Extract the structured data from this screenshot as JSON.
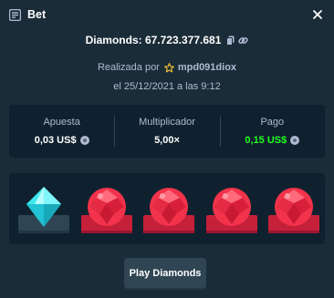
{
  "header": {
    "title": "Bet"
  },
  "bet": {
    "diamonds_label": "Diamonds: 67.723.377.681",
    "realizada_prefix": "Realizada por",
    "username": "mpd091diox",
    "date": "el 25/12/2021 a las 9:12"
  },
  "stats": {
    "apuesta_label": "Apuesta",
    "apuesta_value": "0,03 US$",
    "multiplicador_label": "Multiplicador",
    "multiplicador_value": "5,00×",
    "pago_label": "Pago",
    "pago_value": "0,15 US$"
  },
  "board": {
    "gems": [
      "cyan",
      "red",
      "red",
      "red",
      "red"
    ],
    "colors": {
      "cyan": "#3de8f0",
      "red": "#f2334b",
      "red_base": "#c5203a",
      "cyan_base": "#2f4553"
    }
  },
  "actions": {
    "play_label": "Play Diamonds"
  },
  "icons": {
    "bet": "bet-slip-icon",
    "close": "close-icon",
    "copy": "copy-icon",
    "link": "link-icon",
    "star": "star-icon",
    "coin": "coin-icon"
  },
  "colors": {
    "background": "#1a2c38",
    "panel": "#0f212e",
    "positive": "#1fff20",
    "button": "#2f4553"
  }
}
